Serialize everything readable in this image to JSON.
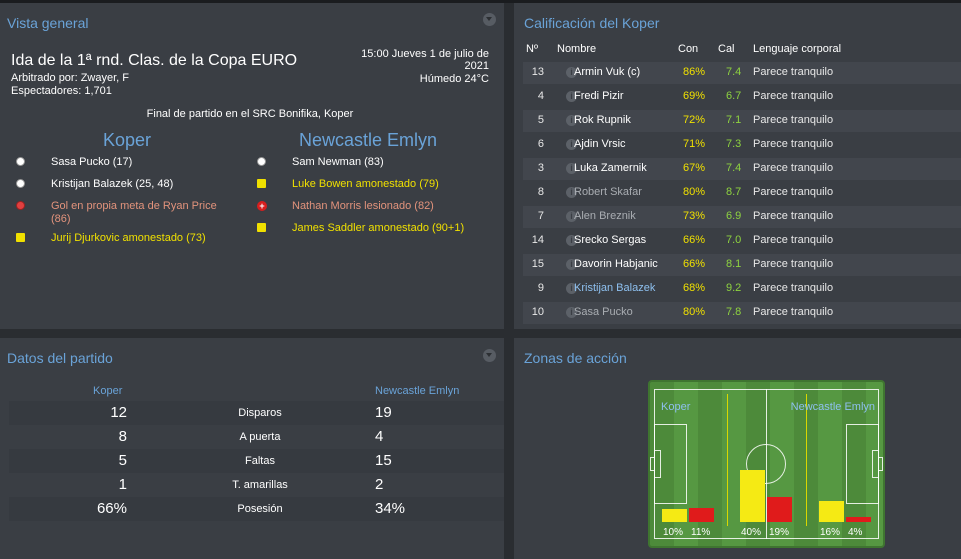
{
  "overview": {
    "title": "Vista general",
    "match_title": "Ida de la 1ª rnd. Clas. de la Copa EURO",
    "referee": "Arbitrado por: Zwayer, F",
    "spectators": "Espectadores: 1,701",
    "datetime_line1": "15:00 Jueves 1 de julio de",
    "datetime_line2": "2021",
    "weather": "Húmedo 24°C",
    "result_text": "Final de partido en el SRC Bonifika, Koper",
    "home_team": "Koper",
    "away_team": "Newcastle Emlyn",
    "home_events": [
      {
        "icon": "goal",
        "text": "Sasa Pucko (17)",
        "color": "#ffffff"
      },
      {
        "icon": "goal",
        "text": "Kristijan Balazek (25, 48)",
        "color": "#ffffff"
      },
      {
        "icon": "own-goal",
        "text": "Gol en propia meta de Ryan Price",
        "text2": "(86)",
        "color": "#e2937c"
      },
      {
        "icon": "yellow-card",
        "text": "Jurij Djurkovic amonestado (73)",
        "color": "#f0e000"
      }
    ],
    "away_events": [
      {
        "icon": "goal",
        "text": "Sam Newman (83)",
        "color": "#ffffff"
      },
      {
        "icon": "yellow-card",
        "text": "Luke Bowen amonestado (79)",
        "color": "#f0e000"
      },
      {
        "icon": "injury",
        "text": "Nathan Morris lesionado (82)",
        "color": "#e2937c"
      },
      {
        "icon": "yellow-card",
        "text": "James Saddler amonestado (90+1)",
        "color": "#f0e000"
      }
    ]
  },
  "ratings": {
    "title": "Calificación del Koper",
    "columns": {
      "num": "Nº",
      "name": "Nombre",
      "con": "Con",
      "cal": "Cal",
      "body": "Lenguaje corporal"
    },
    "rows": [
      {
        "num": "13",
        "name": "Armin Vuk (c)",
        "con": "86%",
        "cal": "7.4",
        "body": "Parece tranquilo",
        "style": "normal"
      },
      {
        "num": "4",
        "name": "Fredi Pizir",
        "con": "69%",
        "cal": "6.7",
        "body": "Parece tranquilo",
        "style": "normal"
      },
      {
        "num": "5",
        "name": "Rok Rupnik",
        "con": "72%",
        "cal": "7.1",
        "body": "Parece tranquilo",
        "style": "normal"
      },
      {
        "num": "6",
        "name": "Ajdin Vrsic",
        "con": "71%",
        "cal": "7.3",
        "body": "Parece tranquilo",
        "style": "normal"
      },
      {
        "num": "3",
        "name": "Luka Zamernik",
        "con": "67%",
        "cal": "7.4",
        "body": "Parece tranquilo",
        "style": "normal"
      },
      {
        "num": "8",
        "name": "Robert Skafar",
        "con": "80%",
        "cal": "8.7",
        "body": "Parece tranquilo",
        "style": "sub"
      },
      {
        "num": "7",
        "name": "Alen Breznik",
        "con": "73%",
        "cal": "6.9",
        "body": "Parece tranquilo",
        "style": "sub"
      },
      {
        "num": "14",
        "name": "Srecko Sergas",
        "con": "66%",
        "cal": "7.0",
        "body": "Parece tranquilo",
        "style": "normal"
      },
      {
        "num": "15",
        "name": "Davorin Habjanic",
        "con": "66%",
        "cal": "8.1",
        "body": "Parece tranquilo",
        "style": "normal"
      },
      {
        "num": "9",
        "name": "Kristijan Balazek",
        "con": "68%",
        "cal": "9.2",
        "body": "Parece tranquilo",
        "style": "star"
      },
      {
        "num": "10",
        "name": "Sasa Pucko",
        "con": "80%",
        "cal": "7.8",
        "body": "Parece tranquilo",
        "style": "sub"
      }
    ]
  },
  "match_data": {
    "title": "Datos del partido",
    "home": "Koper",
    "away": "Newcastle Emlyn",
    "rows": [
      {
        "label": "Disparos",
        "home": "12",
        "away": "19"
      },
      {
        "label": "A puerta",
        "home": "8",
        "away": "4"
      },
      {
        "label": "Faltas",
        "home": "5",
        "away": "15"
      },
      {
        "label": "T. amarillas",
        "home": "1",
        "away": "2"
      },
      {
        "label": "Posesión",
        "home": "66%",
        "away": "34%"
      }
    ]
  },
  "zones": {
    "title": "Zonas de acción",
    "home": "Koper",
    "away": "Newcastle Emlyn",
    "home_color": "#f5ea14",
    "away_color": "#e01b1b",
    "thirds": [
      {
        "home": 10,
        "away": 11,
        "home_label": "10%",
        "away_label": "11%"
      },
      {
        "home": 40,
        "away": 19,
        "home_label": "40%",
        "away_label": "19%"
      },
      {
        "home": 16,
        "away": 4,
        "home_label": "16%",
        "away_label": "4%"
      }
    ]
  }
}
